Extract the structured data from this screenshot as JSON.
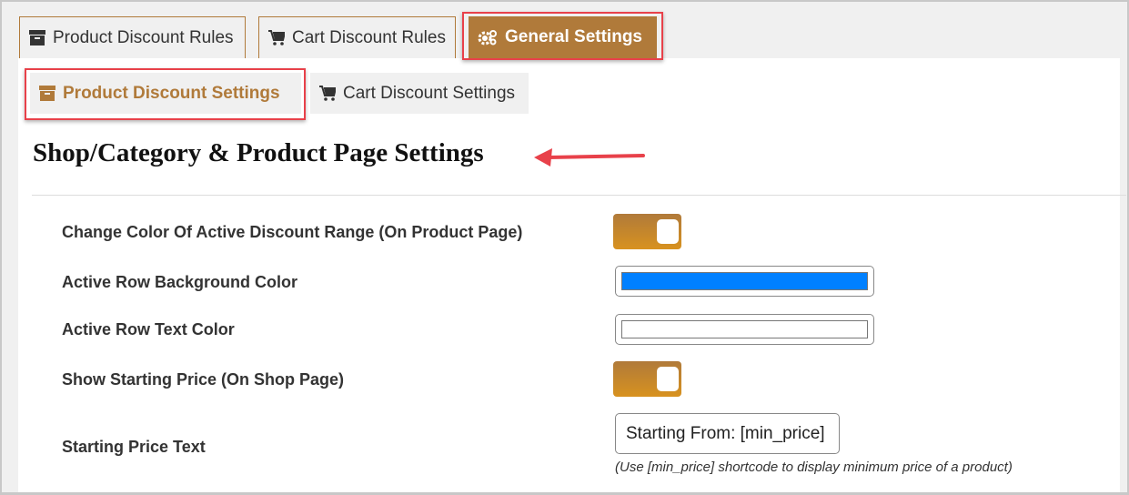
{
  "tabs": [
    {
      "label": "Product Discount Rules",
      "icon": "archive-icon"
    },
    {
      "label": "Cart Discount Rules",
      "icon": "cart-icon"
    },
    {
      "label": "General Settings",
      "icon": "gears-icon",
      "active": true
    }
  ],
  "subtabs": [
    {
      "label": "Product Discount Settings",
      "icon": "archive-icon",
      "active": true
    },
    {
      "label": "Cart Discount Settings",
      "icon": "cart-icon"
    }
  ],
  "section_title": "Shop/Category & Product Page Settings",
  "settings": {
    "change_color": {
      "label": "Change Color Of Active Discount Range (On Product Page)",
      "enabled": true
    },
    "active_bg": {
      "label": "Active Row Background Color",
      "value": "#0080ff"
    },
    "active_text": {
      "label": "Active Row Text Color",
      "value": "#ffffff"
    },
    "show_starting": {
      "label": "Show Starting Price (On Shop Page)",
      "enabled": true
    },
    "starting_text": {
      "label": "Starting Price Text",
      "value": "Starting From: [min_price]",
      "hint": "(Use [min_price] shortcode to display minimum price of a product)"
    }
  },
  "colors": {
    "accent": "#b07a3a",
    "highlight": "#e8414a"
  }
}
